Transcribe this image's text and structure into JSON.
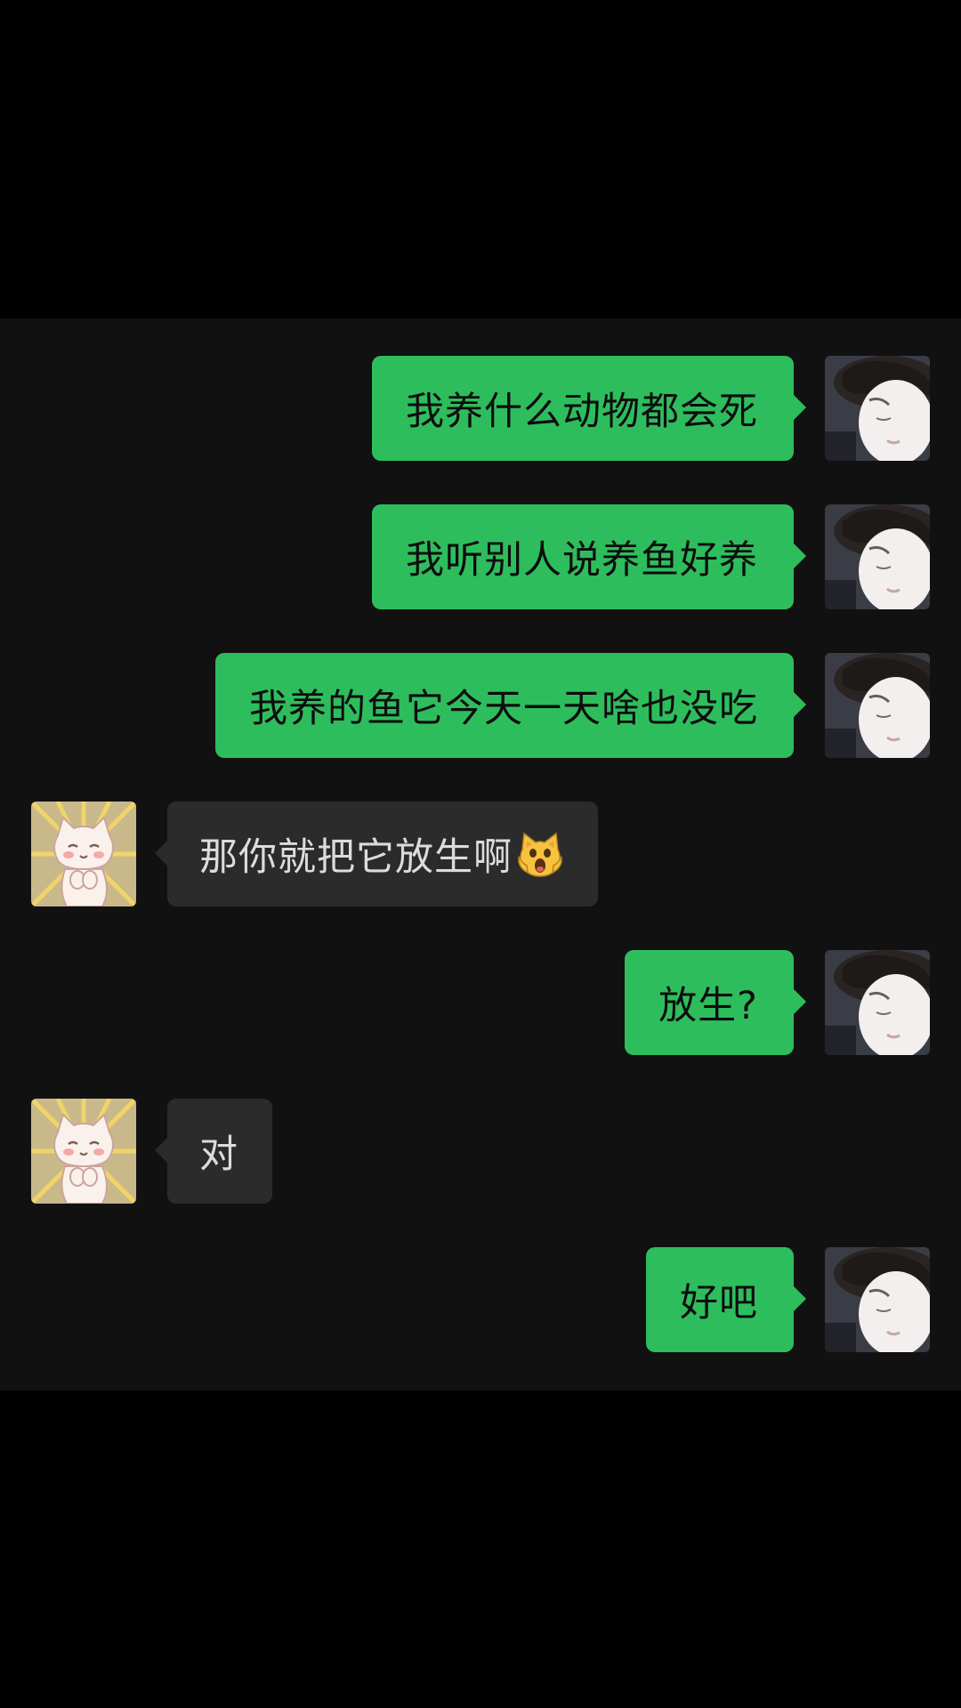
{
  "messages": [
    {
      "sender": "me",
      "text": "我养什么动物都会死"
    },
    {
      "sender": "me",
      "text": "我听别人说养鱼好养"
    },
    {
      "sender": "me",
      "text": "我养的鱼它今天一天啥也没吃"
    },
    {
      "sender": "them",
      "text": "那你就把它放生啊",
      "emoji": "weary-cat-face-icon"
    },
    {
      "sender": "me",
      "text": "放生?"
    },
    {
      "sender": "them",
      "text": "对"
    },
    {
      "sender": "me",
      "text": "好吧"
    }
  ],
  "colors": {
    "sent_bubble": "#2ebd5d",
    "received_bubble": "#2b2b2b",
    "chat_background": "#111111"
  }
}
